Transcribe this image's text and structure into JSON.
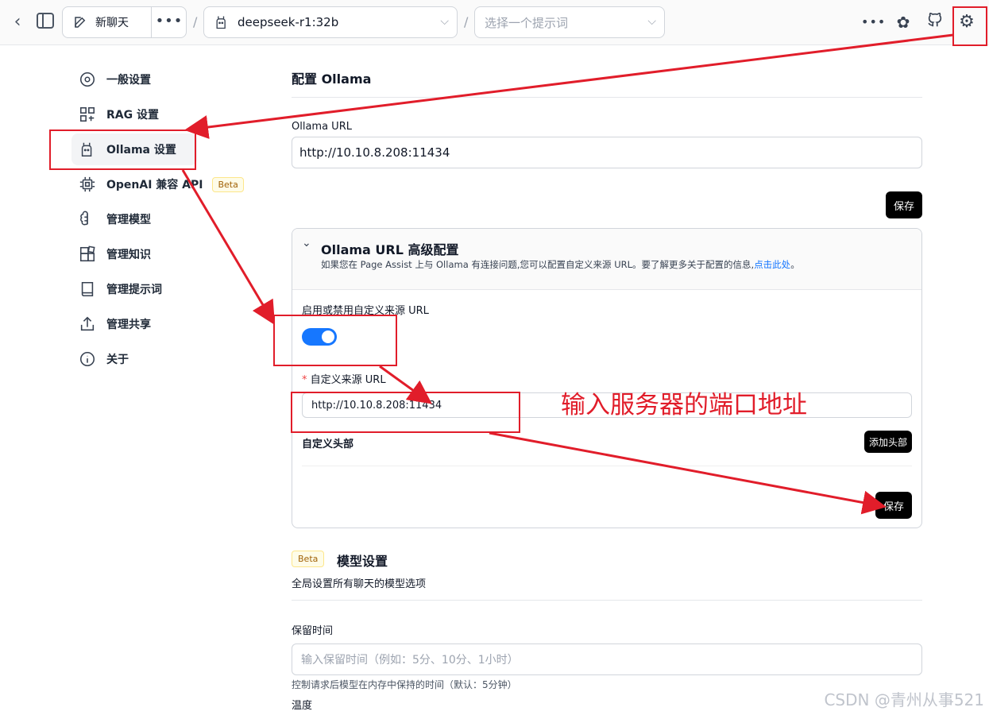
{
  "topbar": {
    "new_chat_label": "新聊天",
    "model_value": "deepseek-r1:32b",
    "prompt_placeholder": "选择一个提示词"
  },
  "sidebar": {
    "items": [
      {
        "label": "一般设置",
        "icon": "gear-circle-icon"
      },
      {
        "label": "RAG 设置",
        "icon": "scan-icon"
      },
      {
        "label": "Ollama 设置",
        "icon": "llama-icon",
        "active": true
      },
      {
        "label": "OpenAI 兼容 API",
        "icon": "chip-icon",
        "badge": "Beta"
      },
      {
        "label": "管理模型",
        "icon": "brain-icon"
      },
      {
        "label": "管理知识",
        "icon": "blocks-icon"
      },
      {
        "label": "管理提示词",
        "icon": "book-icon"
      },
      {
        "label": "管理共享",
        "icon": "share-icon"
      },
      {
        "label": "关于",
        "icon": "info-icon"
      }
    ]
  },
  "main": {
    "section_title": "配置 Ollama",
    "ollama_url_label": "Ollama URL",
    "ollama_url_value": "http://10.10.8.208:11434",
    "save_label": "保存",
    "advanced": {
      "title": "Ollama URL 高级配置",
      "desc": "如果您在 Page Assist 上与 Ollama 有连接问题,您可以配置自定义来源 URL。要了解更多关于配置的信息,",
      "link_text": "点击此处",
      "desc_end": "。",
      "toggle_label": "启用或禁用自定义来源 URL",
      "toggle_on": true,
      "required_mark": "*",
      "origin_label": "自定义来源 URL",
      "origin_value": "http://10.10.8.208:11434",
      "headers_label": "自定义头部",
      "add_header_label": "添加头部",
      "save_label": "保存"
    },
    "model_settings": {
      "badge": "Beta",
      "title": "模型设置",
      "desc": "全局设置所有聊天的模型选项",
      "keep_alive_label": "保留时间",
      "keep_alive_placeholder": "输入保留时间（例如：5分、10分、1小时）",
      "keep_alive_help": "控制请求后模型在内存中保持的时间（默认：5分钟）",
      "temperature_label": "温度"
    }
  },
  "annotation": {
    "text": "输入服务器的端口地址",
    "color": "#e11d2a"
  },
  "watermark": "CSDN @青州从事521"
}
